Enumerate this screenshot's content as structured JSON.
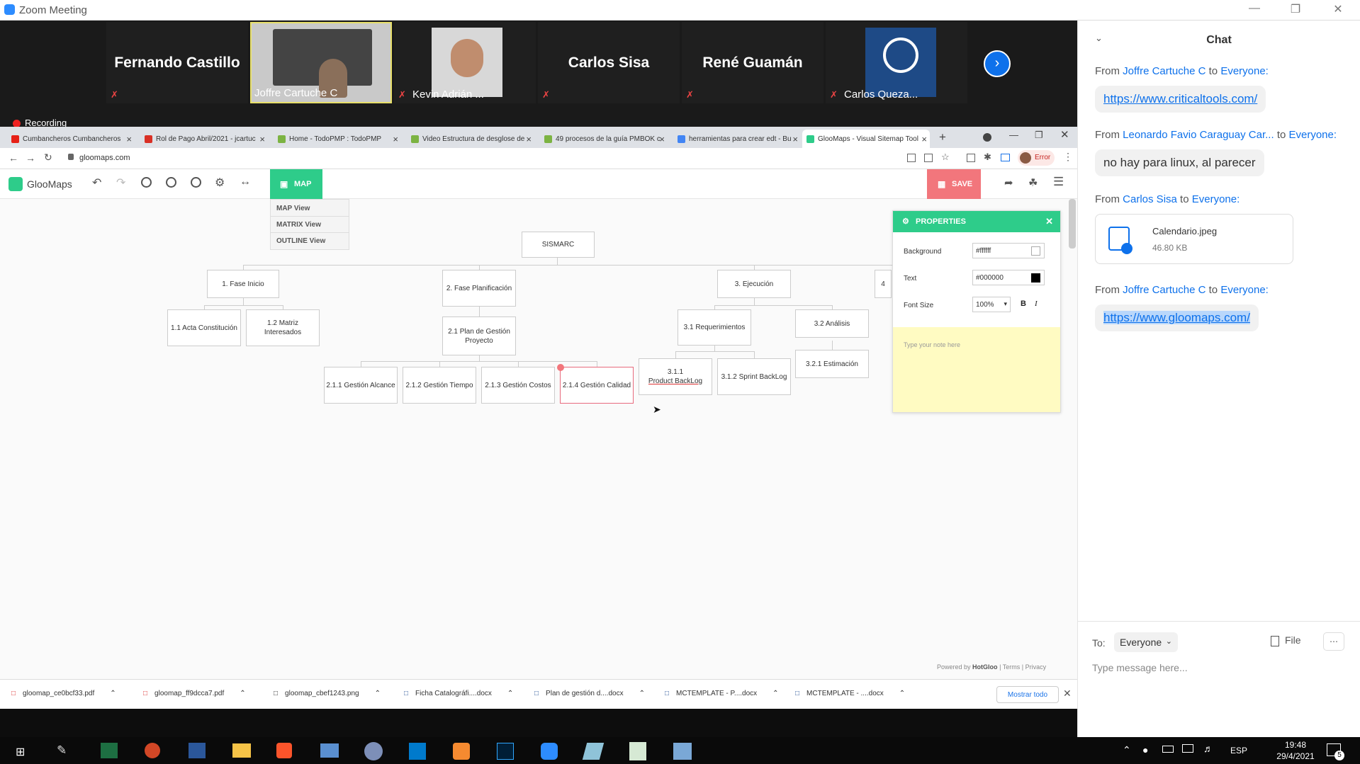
{
  "zoom": {
    "title": "Zoom Meeting"
  },
  "participants": [
    {
      "name": "Fernando Castillo",
      "label": ""
    },
    {
      "name": "",
      "label": "Joffre Cartuche C"
    },
    {
      "name": "",
      "label": "Kevin Adrián ..."
    },
    {
      "name": "Carlos Sisa",
      "label": ""
    },
    {
      "name": "René Guamán",
      "label": ""
    },
    {
      "name": "",
      "label": "Carlos Queza..."
    }
  ],
  "recording": "Recording",
  "tabs": [
    {
      "label": "Cumbancheros Cumbancheros",
      "color": "#e62117"
    },
    {
      "label": "Rol de Pago Abril/2021 - jcartuc",
      "color": "#d93025"
    },
    {
      "label": "Home - TodoPMP : TodoPMP",
      "color": "#7cb342"
    },
    {
      "label": "Video Estructura de desglose de",
      "color": "#7cb342"
    },
    {
      "label": "49 procesos de la guía PMBOK c",
      "color": "#7cb342"
    },
    {
      "label": "herramientas para crear edt - Bu",
      "color": "#4285f4"
    },
    {
      "label": "GlooMaps - Visual Sitemap Tool",
      "color": "#2ecc8a"
    }
  ],
  "address": "gloomaps.com",
  "error_label": "Error",
  "gloomaps": {
    "logo": "GlooMaps",
    "map_button": "MAP",
    "save_button": "SAVE",
    "view_menu": [
      "MAP View",
      "MATRIX View",
      "OUTLINE View"
    ],
    "powered_by": "Powered by",
    "hotgloo": "HotGloo",
    "terms": "Terms",
    "privacy": "Privacy",
    "separator": "|"
  },
  "sitemap": {
    "root": "SISMARC",
    "n1": "1. Fase Inicio",
    "n11": "1.1 Acta Constitución",
    "n12": "1.2 Matriz Interesados",
    "n2": "2. Fase Planificación",
    "n21": "2.1 Plan de Gestión Proyecto",
    "n211": "2.1.1 Gestión Alcance",
    "n212": "2.1.2 Gestión Tiempo",
    "n213": "2.1.3 Gestión Costos",
    "n214": "2.1.4 Gestión Calidad",
    "n3": "3. Ejecución",
    "n31": "3.1 Requerimientos",
    "n311a": "3.1.1",
    "n311b": "Product BackLog",
    "n312": "3.1.2 Sprint BackLog",
    "n32": "3.2 Análisis",
    "n321": "3.2.1 Estimación",
    "n4": "4"
  },
  "properties": {
    "title": "PROPERTIES",
    "background_label": "Background",
    "background_value": "#ffffff",
    "text_label": "Text",
    "text_value": "#000000",
    "fontsize_label": "Font Size",
    "fontsize_value": "100%",
    "bold": "B",
    "italic": "I",
    "note_placeholder": "Type your note here"
  },
  "downloads": [
    "gloomap_ce0bcf33.pdf",
    "gloomap_ff9dcca7.pdf",
    "gloomap_cbef1243.png",
    "Ficha Catalográfi....docx",
    "Plan de gestión d....docx",
    "MCTEMPLATE - P....docx",
    "MCTEMPLATE - ....docx"
  ],
  "show_all": "Mostrar todo",
  "chat": {
    "title": "Chat",
    "from": "From",
    "to": "to",
    "msgs": [
      {
        "sender": "Joffre Cartuche C",
        "target": "Everyone:",
        "text": "https://www.criticaltools.com/"
      },
      {
        "sender": "Leonardo Favio Caraguay Car...",
        "target": "Everyone:",
        "text": "no hay para linux, al parecer"
      },
      {
        "sender": "Carlos Sisa",
        "target": "Everyone:",
        "file": "Calendario.jpeg",
        "size": "46.80 KB"
      },
      {
        "sender": "Joffre Cartuche C",
        "target": "Everyone:",
        "text": "https://www.gloomaps.com/"
      }
    ],
    "to_label": "To:",
    "recipient": "Everyone",
    "file_label": "File",
    "input_placeholder": "Type message here..."
  },
  "taskbar": {
    "lang": "ESP",
    "time": "19:48",
    "date": "29/4/2021",
    "notif": "5"
  }
}
